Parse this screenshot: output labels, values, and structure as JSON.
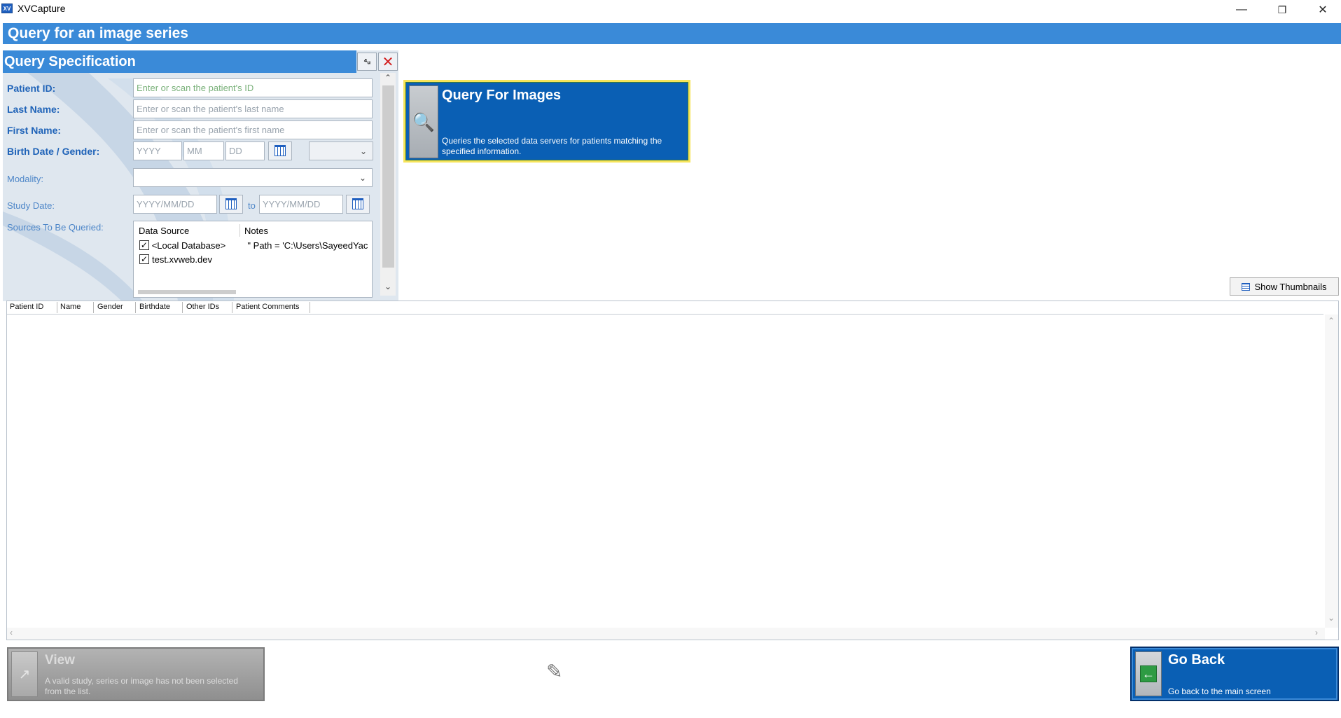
{
  "window": {
    "app_icon": "XV",
    "title": "XVCapture",
    "minimize": "—",
    "restore": "❐",
    "close": "✕"
  },
  "page": {
    "header": "Query for an image series"
  },
  "query_spec": {
    "title": "Query Specification",
    "clear_icon": "✕",
    "patient_id": {
      "label": "Patient ID:",
      "placeholder": "Enter or scan the patient's ID"
    },
    "last_name": {
      "label": "Last Name:",
      "placeholder": "Enter or scan the patient's last name"
    },
    "first_name": {
      "label": "First Name:",
      "placeholder": "Enter or scan the patient's first name"
    },
    "birth": {
      "label": "Birth Date / Gender:",
      "yyyy": "YYYY",
      "mm": "MM",
      "dd": "DD"
    },
    "modality": {
      "label": "Modality:"
    },
    "study_date": {
      "label": "Study Date:",
      "from": "YYYY/MM/DD",
      "to_label": "to",
      "to": "YYYY/MM/DD"
    },
    "sources": {
      "label": "Sources To Be Queried:",
      "col_source": "Data Source",
      "col_notes": "Notes",
      "rows": [
        {
          "name": "<Local Database>",
          "notes": "\" Path = 'C:\\Users\\SayeedYac",
          "checked": "✓"
        },
        {
          "name": "test.xvweb.dev",
          "notes": "",
          "checked": "✓"
        }
      ]
    }
  },
  "query_button": {
    "title": "Query For Images",
    "description": "Queries the selected data servers for patients matching the specified information."
  },
  "thumbnails": {
    "label": "Show Thumbnails"
  },
  "results": {
    "columns": [
      "Patient ID",
      "Name",
      "Gender",
      "Birthdate",
      "Other IDs",
      "Patient Comments"
    ]
  },
  "view_button": {
    "title": "View",
    "description": "A valid study, series or image has not been selected from the list."
  },
  "go_back_button": {
    "title": "Go Back",
    "description": "Go back to the main screen",
    "arrow": "←"
  },
  "colors": {
    "accent": "#3a8ad8",
    "button_blue": "#0a5fb4",
    "label_blue": "#1f63b8"
  }
}
